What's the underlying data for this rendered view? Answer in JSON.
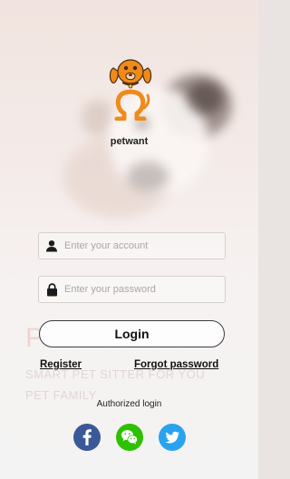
{
  "brand": {
    "name": "petwant"
  },
  "form": {
    "account_placeholder": "Enter your account",
    "password_placeholder": "Enter your password",
    "login_label": "Login"
  },
  "links": {
    "register": "Register",
    "forgot_password": "Forgot password"
  },
  "watermark": {
    "letter": "P",
    "line1": "SMART PET SITTER FOR YOU",
    "line2": "PET FAMILY"
  },
  "auth": {
    "label": "Authorized login"
  },
  "social": [
    {
      "name": "facebook-icon",
      "color": "#3b5998"
    },
    {
      "name": "wechat-icon",
      "color": "#2dc100"
    },
    {
      "name": "twitter-icon",
      "color": "#2aa3ef"
    }
  ],
  "colors": {
    "logo_orange": "#f08a1a",
    "logo_dark": "#4a2a10"
  }
}
